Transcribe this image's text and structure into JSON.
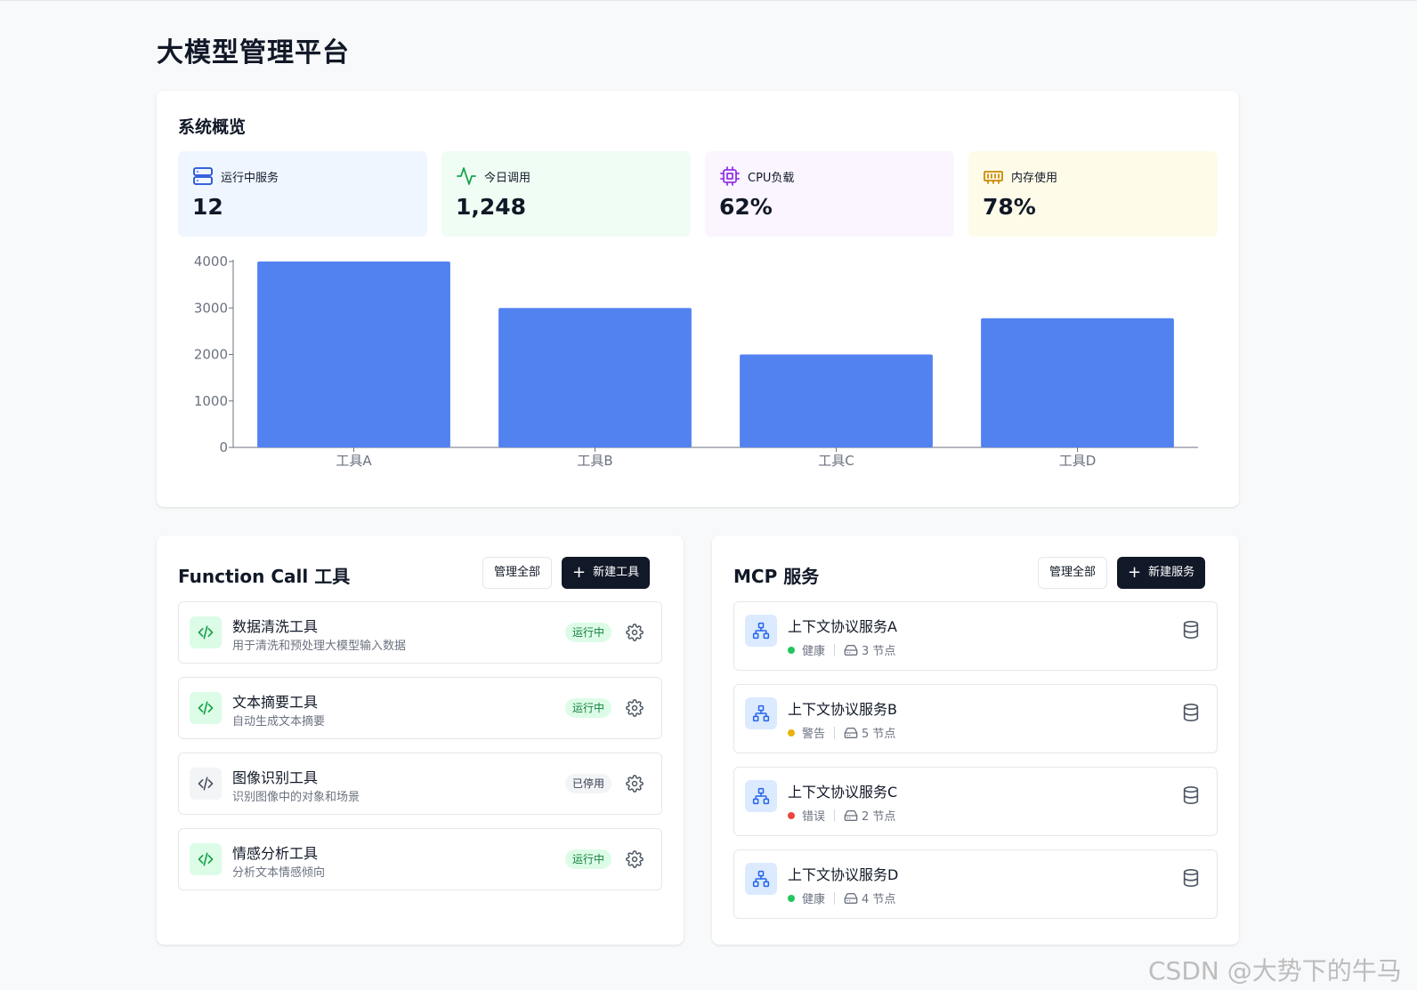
{
  "page": {
    "title": "大模型管理平台"
  },
  "overview": {
    "title": "系统概览",
    "stats": [
      {
        "label": "运行中服务",
        "value": "12",
        "icon": "server-icon",
        "color": "#1d4ed8"
      },
      {
        "label": "今日调用",
        "value": "1,248",
        "icon": "activity-icon",
        "color": "#16a34a"
      },
      {
        "label": "CPU负载",
        "value": "62%",
        "icon": "cpu-icon",
        "color": "#9333ea"
      },
      {
        "label": "内存使用",
        "value": "78%",
        "icon": "memory-icon",
        "color": "#ca8a04"
      }
    ]
  },
  "chart_data": {
    "type": "bar",
    "categories": [
      "工具A",
      "工具B",
      "工具C",
      "工具D"
    ],
    "values": [
      4000,
      3000,
      2000,
      2780
    ],
    "ylim": [
      0,
      4000
    ],
    "yticks": [
      "0",
      "1000",
      "2000",
      "3000",
      "4000"
    ],
    "bar_color": "#5282f0",
    "grid": false
  },
  "function_tools": {
    "title": "Function Call 工具",
    "manage_label": "管理全部",
    "new_label": "新建工具",
    "items": [
      {
        "name": "数据清洗工具",
        "desc": "用于清洗和预处理大模型输入数据",
        "status": "运行中"
      },
      {
        "name": "文本摘要工具",
        "desc": "自动生成文本摘要",
        "status": "运行中"
      },
      {
        "name": "图像识别工具",
        "desc": "识别图像中的对象和场景",
        "status": "已停用"
      },
      {
        "name": "情感分析工具",
        "desc": "分析文本情感倾向",
        "status": "运行中"
      }
    ]
  },
  "mcp_services": {
    "title": "MCP 服务",
    "manage_label": "管理全部",
    "new_label": "新建服务",
    "items": [
      {
        "name": "上下文协议服务A",
        "health": "健康",
        "health_color": "#22c55e",
        "nodes": "3 节点"
      },
      {
        "name": "上下文协议服务B",
        "health": "警告",
        "health_color": "#eab308",
        "nodes": "5 节点"
      },
      {
        "name": "上下文协议服务C",
        "health": "错误",
        "health_color": "#ef4444",
        "nodes": "2 节点"
      },
      {
        "name": "上下文协议服务D",
        "health": "健康",
        "health_color": "#22c55e",
        "nodes": "4 节点"
      }
    ]
  },
  "watermark": "CSDN @大势下的牛马"
}
